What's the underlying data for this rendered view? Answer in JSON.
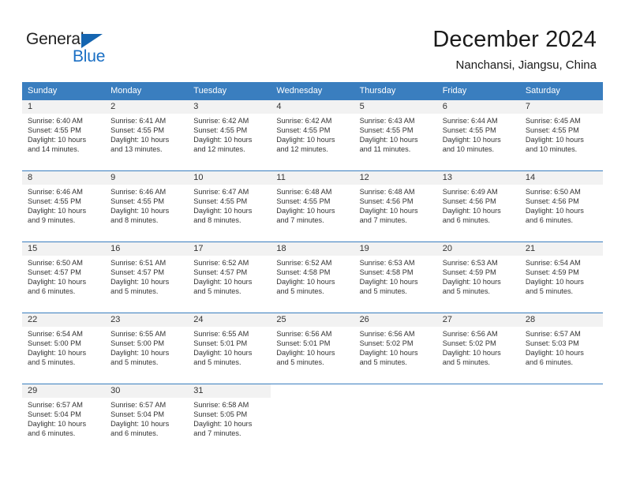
{
  "logo": {
    "word_dark": "General",
    "word_blue": "Blue",
    "triangle_color": "#1565b0",
    "blue_text_color": "#1a6fc4"
  },
  "header": {
    "title": "December 2024",
    "subtitle": "Nanchansi, Jiangsu, China"
  },
  "theme": {
    "header_blue": "#3a7ebf",
    "band_gray": "#f2f2f2",
    "text_color": "#333333"
  },
  "weekday_headers": [
    "Sunday",
    "Monday",
    "Tuesday",
    "Wednesday",
    "Thursday",
    "Friday",
    "Saturday"
  ],
  "weeks": [
    [
      {
        "day": "1",
        "sunrise": "Sunrise: 6:40 AM",
        "sunset": "Sunset: 4:55 PM",
        "daylight_1": "Daylight: 10 hours",
        "daylight_2": "and 14 minutes."
      },
      {
        "day": "2",
        "sunrise": "Sunrise: 6:41 AM",
        "sunset": "Sunset: 4:55 PM",
        "daylight_1": "Daylight: 10 hours",
        "daylight_2": "and 13 minutes."
      },
      {
        "day": "3",
        "sunrise": "Sunrise: 6:42 AM",
        "sunset": "Sunset: 4:55 PM",
        "daylight_1": "Daylight: 10 hours",
        "daylight_2": "and 12 minutes."
      },
      {
        "day": "4",
        "sunrise": "Sunrise: 6:42 AM",
        "sunset": "Sunset: 4:55 PM",
        "daylight_1": "Daylight: 10 hours",
        "daylight_2": "and 12 minutes."
      },
      {
        "day": "5",
        "sunrise": "Sunrise: 6:43 AM",
        "sunset": "Sunset: 4:55 PM",
        "daylight_1": "Daylight: 10 hours",
        "daylight_2": "and 11 minutes."
      },
      {
        "day": "6",
        "sunrise": "Sunrise: 6:44 AM",
        "sunset": "Sunset: 4:55 PM",
        "daylight_1": "Daylight: 10 hours",
        "daylight_2": "and 10 minutes."
      },
      {
        "day": "7",
        "sunrise": "Sunrise: 6:45 AM",
        "sunset": "Sunset: 4:55 PM",
        "daylight_1": "Daylight: 10 hours",
        "daylight_2": "and 10 minutes."
      }
    ],
    [
      {
        "day": "8",
        "sunrise": "Sunrise: 6:46 AM",
        "sunset": "Sunset: 4:55 PM",
        "daylight_1": "Daylight: 10 hours",
        "daylight_2": "and 9 minutes."
      },
      {
        "day": "9",
        "sunrise": "Sunrise: 6:46 AM",
        "sunset": "Sunset: 4:55 PM",
        "daylight_1": "Daylight: 10 hours",
        "daylight_2": "and 8 minutes."
      },
      {
        "day": "10",
        "sunrise": "Sunrise: 6:47 AM",
        "sunset": "Sunset: 4:55 PM",
        "daylight_1": "Daylight: 10 hours",
        "daylight_2": "and 8 minutes."
      },
      {
        "day": "11",
        "sunrise": "Sunrise: 6:48 AM",
        "sunset": "Sunset: 4:55 PM",
        "daylight_1": "Daylight: 10 hours",
        "daylight_2": "and 7 minutes."
      },
      {
        "day": "12",
        "sunrise": "Sunrise: 6:48 AM",
        "sunset": "Sunset: 4:56 PM",
        "daylight_1": "Daylight: 10 hours",
        "daylight_2": "and 7 minutes."
      },
      {
        "day": "13",
        "sunrise": "Sunrise: 6:49 AM",
        "sunset": "Sunset: 4:56 PM",
        "daylight_1": "Daylight: 10 hours",
        "daylight_2": "and 6 minutes."
      },
      {
        "day": "14",
        "sunrise": "Sunrise: 6:50 AM",
        "sunset": "Sunset: 4:56 PM",
        "daylight_1": "Daylight: 10 hours",
        "daylight_2": "and 6 minutes."
      }
    ],
    [
      {
        "day": "15",
        "sunrise": "Sunrise: 6:50 AM",
        "sunset": "Sunset: 4:57 PM",
        "daylight_1": "Daylight: 10 hours",
        "daylight_2": "and 6 minutes."
      },
      {
        "day": "16",
        "sunrise": "Sunrise: 6:51 AM",
        "sunset": "Sunset: 4:57 PM",
        "daylight_1": "Daylight: 10 hours",
        "daylight_2": "and 5 minutes."
      },
      {
        "day": "17",
        "sunrise": "Sunrise: 6:52 AM",
        "sunset": "Sunset: 4:57 PM",
        "daylight_1": "Daylight: 10 hours",
        "daylight_2": "and 5 minutes."
      },
      {
        "day": "18",
        "sunrise": "Sunrise: 6:52 AM",
        "sunset": "Sunset: 4:58 PM",
        "daylight_1": "Daylight: 10 hours",
        "daylight_2": "and 5 minutes."
      },
      {
        "day": "19",
        "sunrise": "Sunrise: 6:53 AM",
        "sunset": "Sunset: 4:58 PM",
        "daylight_1": "Daylight: 10 hours",
        "daylight_2": "and 5 minutes."
      },
      {
        "day": "20",
        "sunrise": "Sunrise: 6:53 AM",
        "sunset": "Sunset: 4:59 PM",
        "daylight_1": "Daylight: 10 hours",
        "daylight_2": "and 5 minutes."
      },
      {
        "day": "21",
        "sunrise": "Sunrise: 6:54 AM",
        "sunset": "Sunset: 4:59 PM",
        "daylight_1": "Daylight: 10 hours",
        "daylight_2": "and 5 minutes."
      }
    ],
    [
      {
        "day": "22",
        "sunrise": "Sunrise: 6:54 AM",
        "sunset": "Sunset: 5:00 PM",
        "daylight_1": "Daylight: 10 hours",
        "daylight_2": "and 5 minutes."
      },
      {
        "day": "23",
        "sunrise": "Sunrise: 6:55 AM",
        "sunset": "Sunset: 5:00 PM",
        "daylight_1": "Daylight: 10 hours",
        "daylight_2": "and 5 minutes."
      },
      {
        "day": "24",
        "sunrise": "Sunrise: 6:55 AM",
        "sunset": "Sunset: 5:01 PM",
        "daylight_1": "Daylight: 10 hours",
        "daylight_2": "and 5 minutes."
      },
      {
        "day": "25",
        "sunrise": "Sunrise: 6:56 AM",
        "sunset": "Sunset: 5:01 PM",
        "daylight_1": "Daylight: 10 hours",
        "daylight_2": "and 5 minutes."
      },
      {
        "day": "26",
        "sunrise": "Sunrise: 6:56 AM",
        "sunset": "Sunset: 5:02 PM",
        "daylight_1": "Daylight: 10 hours",
        "daylight_2": "and 5 minutes."
      },
      {
        "day": "27",
        "sunrise": "Sunrise: 6:56 AM",
        "sunset": "Sunset: 5:02 PM",
        "daylight_1": "Daylight: 10 hours",
        "daylight_2": "and 5 minutes."
      },
      {
        "day": "28",
        "sunrise": "Sunrise: 6:57 AM",
        "sunset": "Sunset: 5:03 PM",
        "daylight_1": "Daylight: 10 hours",
        "daylight_2": "and 6 minutes."
      }
    ],
    [
      {
        "day": "29",
        "sunrise": "Sunrise: 6:57 AM",
        "sunset": "Sunset: 5:04 PM",
        "daylight_1": "Daylight: 10 hours",
        "daylight_2": "and 6 minutes."
      },
      {
        "day": "30",
        "sunrise": "Sunrise: 6:57 AM",
        "sunset": "Sunset: 5:04 PM",
        "daylight_1": "Daylight: 10 hours",
        "daylight_2": "and 6 minutes."
      },
      {
        "day": "31",
        "sunrise": "Sunrise: 6:58 AM",
        "sunset": "Sunset: 5:05 PM",
        "daylight_1": "Daylight: 10 hours",
        "daylight_2": "and 7 minutes."
      },
      null,
      null,
      null,
      null
    ]
  ]
}
